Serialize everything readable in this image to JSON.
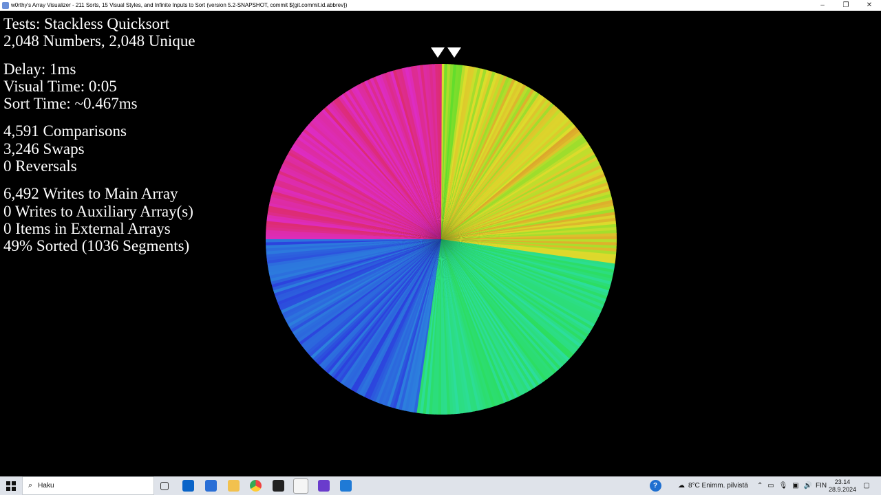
{
  "window": {
    "title": "w0rthy's Array Visualizer - 211 Sorts, 15 Visual Styles, and Infinite Inputs to Sort (version 5.2-SNAPSHOT, commit ${git.commit.id.abbrev})",
    "minimize": "–",
    "maximize": "❐",
    "close": "✕"
  },
  "stats": {
    "test": "Tests: Stackless Quicksort",
    "numbers": "2,048 Numbers, 2,048 Unique",
    "delay": "Delay: 1ms",
    "visual_time": "Visual Time: 0:05",
    "sort_time": "Sort Time: ~0.467ms",
    "comparisons": "4,591 Comparisons",
    "swaps": "3,246 Swaps",
    "reversals": "0 Reversals",
    "writes_main": "6,492 Writes to Main Array",
    "writes_aux": "0 Writes to Auxiliary Array(s)",
    "external": "0 Items in External Arrays",
    "sorted": "49% Sorted (1036 Segments)"
  },
  "visual": {
    "style": "color-circle",
    "array_size": 2048,
    "sorted_fraction": 0.49
  },
  "taskbar": {
    "search_placeholder": "Haku",
    "weather": "8°C Enimm. pilvistä",
    "language": "FIN",
    "time": "23.14",
    "date": "28.9.2024",
    "apps": [
      "task-view-icon",
      "mail-icon",
      "store-icon",
      "file-explorer-icon",
      "chrome-icon",
      "terminal-icon",
      "java-icon",
      "media-icon",
      "photos-icon"
    ]
  },
  "colors": {
    "background": "#000000",
    "text": "#ffffff",
    "taskbar": "#dfe3ea"
  }
}
